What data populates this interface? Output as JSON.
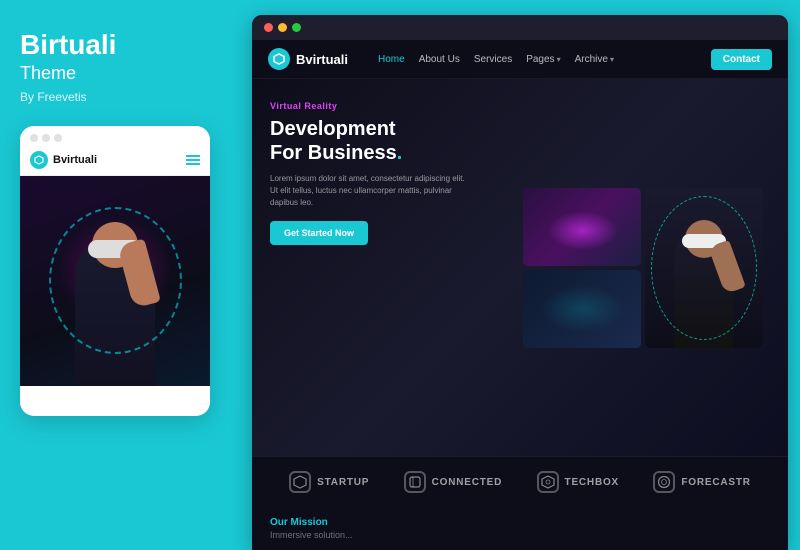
{
  "left": {
    "brand_title": "Birtuali",
    "brand_subtitle": "Theme",
    "brand_by": "By Freevetis"
  },
  "mobile": {
    "logo_text": "Bvirtuali"
  },
  "site": {
    "logo_text": "Bvirtuali",
    "nav": {
      "home": "Home",
      "about": "About Us",
      "services": "Services",
      "pages": "Pages",
      "archive": "Archive",
      "contact": "Contact"
    },
    "hero": {
      "tag": "Virtual Reality",
      "heading_line1": "Development",
      "heading_line2": "For Business",
      "heading_dot": ".",
      "description": "Lorem ipsum dolor sit amet, consectetur adipiscing elit. Ut elit tellus, luctus nec ullamcorper mattis, pulvinar dapibus leo.",
      "cta": "Get Started Now"
    },
    "brands": [
      {
        "name": "STARTUP",
        "icon_type": "hex"
      },
      {
        "name": "CONNECTED",
        "icon_type": "box"
      },
      {
        "name": "TECHBOX",
        "icon_type": "hex"
      },
      {
        "name": "forecastr",
        "icon_type": "circle"
      }
    ],
    "mission": {
      "label": "Our Mission",
      "text": "Immersive solution..."
    }
  },
  "browser_dots": [
    "red",
    "yellow",
    "green"
  ],
  "colors": {
    "accent": "#1ac8d4",
    "dark_bg": "#0d0d1a",
    "purple": "#e040fb"
  }
}
